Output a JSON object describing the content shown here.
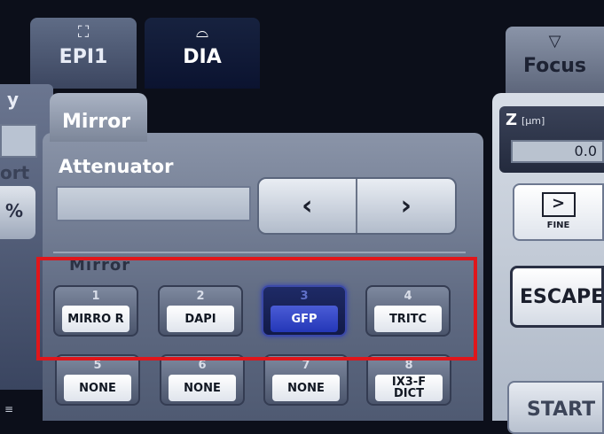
{
  "tabs": [
    {
      "icon": "epi-lamp-icon",
      "label": "EPI1"
    },
    {
      "icon": "dia-lamp-icon",
      "label": "DIA"
    }
  ],
  "focus_tab": {
    "icon": "focus-icon",
    "label": "Focus"
  },
  "left_panel": {
    "fragment_top": "y",
    "fragment_mid": "ort",
    "pct": "%"
  },
  "mirror_tab": {
    "label": "Mirror"
  },
  "attenuator": {
    "title": "Attenuator",
    "value": "",
    "prev_label": "‹",
    "next_label": "›"
  },
  "mirror_section": {
    "title": "Mirror",
    "selected": "3",
    "buttons": [
      {
        "num": "1",
        "label": "MIRRO R"
      },
      {
        "num": "2",
        "label": "DAPI"
      },
      {
        "num": "3",
        "label": "GFP"
      },
      {
        "num": "4",
        "label": "TRITC"
      },
      {
        "num": "5",
        "label": "NONE"
      },
      {
        "num": "6",
        "label": "NONE"
      },
      {
        "num": "7",
        "label": "NONE"
      },
      {
        "num": "8",
        "label": "IX3-F DICT"
      }
    ]
  },
  "right_panel": {
    "z_label": "Z",
    "z_unit": "[μm]",
    "z_value": "0.0",
    "fine_label": "FINE",
    "escape_label": "ESCAPE",
    "start_label": "START"
  },
  "colors": {
    "highlight": "#e0161b",
    "selected_button": "#2437b8"
  }
}
